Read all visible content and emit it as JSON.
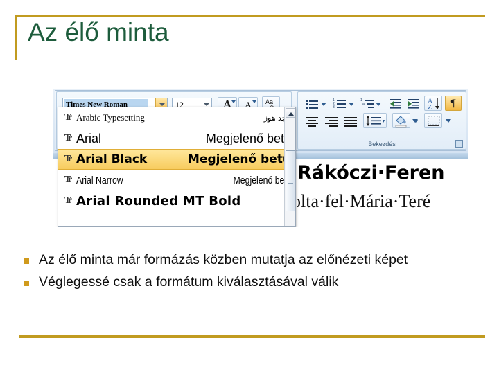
{
  "slide": {
    "title": "Az élő minta",
    "accent_color": "#c19b20",
    "title_color": "#1d5c3c",
    "bullet_color": "#d09a1c",
    "bullets": [
      "Az élő minta már formázás közben mutatja az előnézeti képet",
      "Véglegessé csak a formátum kiválasztásával válik"
    ]
  },
  "screenshot": {
    "ribbon": {
      "font_group": {
        "font_name_value": "Times New Roman",
        "font_name_dropdown_icon": "chevron-down-icon",
        "font_size_value": "12",
        "font_size_dropdown_icon": "chevron-down-icon",
        "grow_font_label": "A",
        "shrink_font_label": "A",
        "clear_formatting_label": "Aa"
      },
      "paragraph_group": {
        "label": "Bekezdés",
        "buttons": [
          "bullets-icon",
          "numbering-icon",
          "multilevel-list-icon",
          "decrease-indent-icon",
          "increase-indent-icon",
          "sort-icon",
          "show-formatting-marks-icon",
          "align-center-icon",
          "align-right-icon",
          "justify-icon",
          "line-spacing-icon",
          "shading-icon",
          "borders-icon"
        ],
        "sort_label": "A\nZ",
        "formatting_marks_glyph": "¶",
        "dialog_launcher_icon": "dialog-launcher-icon"
      }
    },
    "font_dropdown": {
      "items": [
        {
          "name": "Arabic Typesetting",
          "preview": "أبجد هوز",
          "selected": false
        },
        {
          "name": "Arial",
          "preview": "Megjelenő betű",
          "selected": false
        },
        {
          "name": "Arial Black",
          "preview": "Megjelenő betű",
          "selected": true
        },
        {
          "name": "Arial Narrow",
          "preview": "Megjelenő betű",
          "selected": false
        },
        {
          "name": "Arial Rounded MT Bold",
          "preview": "",
          "selected": false
        }
      ],
      "item_icon": "truetype-font-icon",
      "scroll_up_icon": "scroll-up-arrow-icon"
    },
    "document": {
      "line1": "Rákóczi·Feren",
      "line2": "olta·fel·Mária·Teré"
    }
  }
}
